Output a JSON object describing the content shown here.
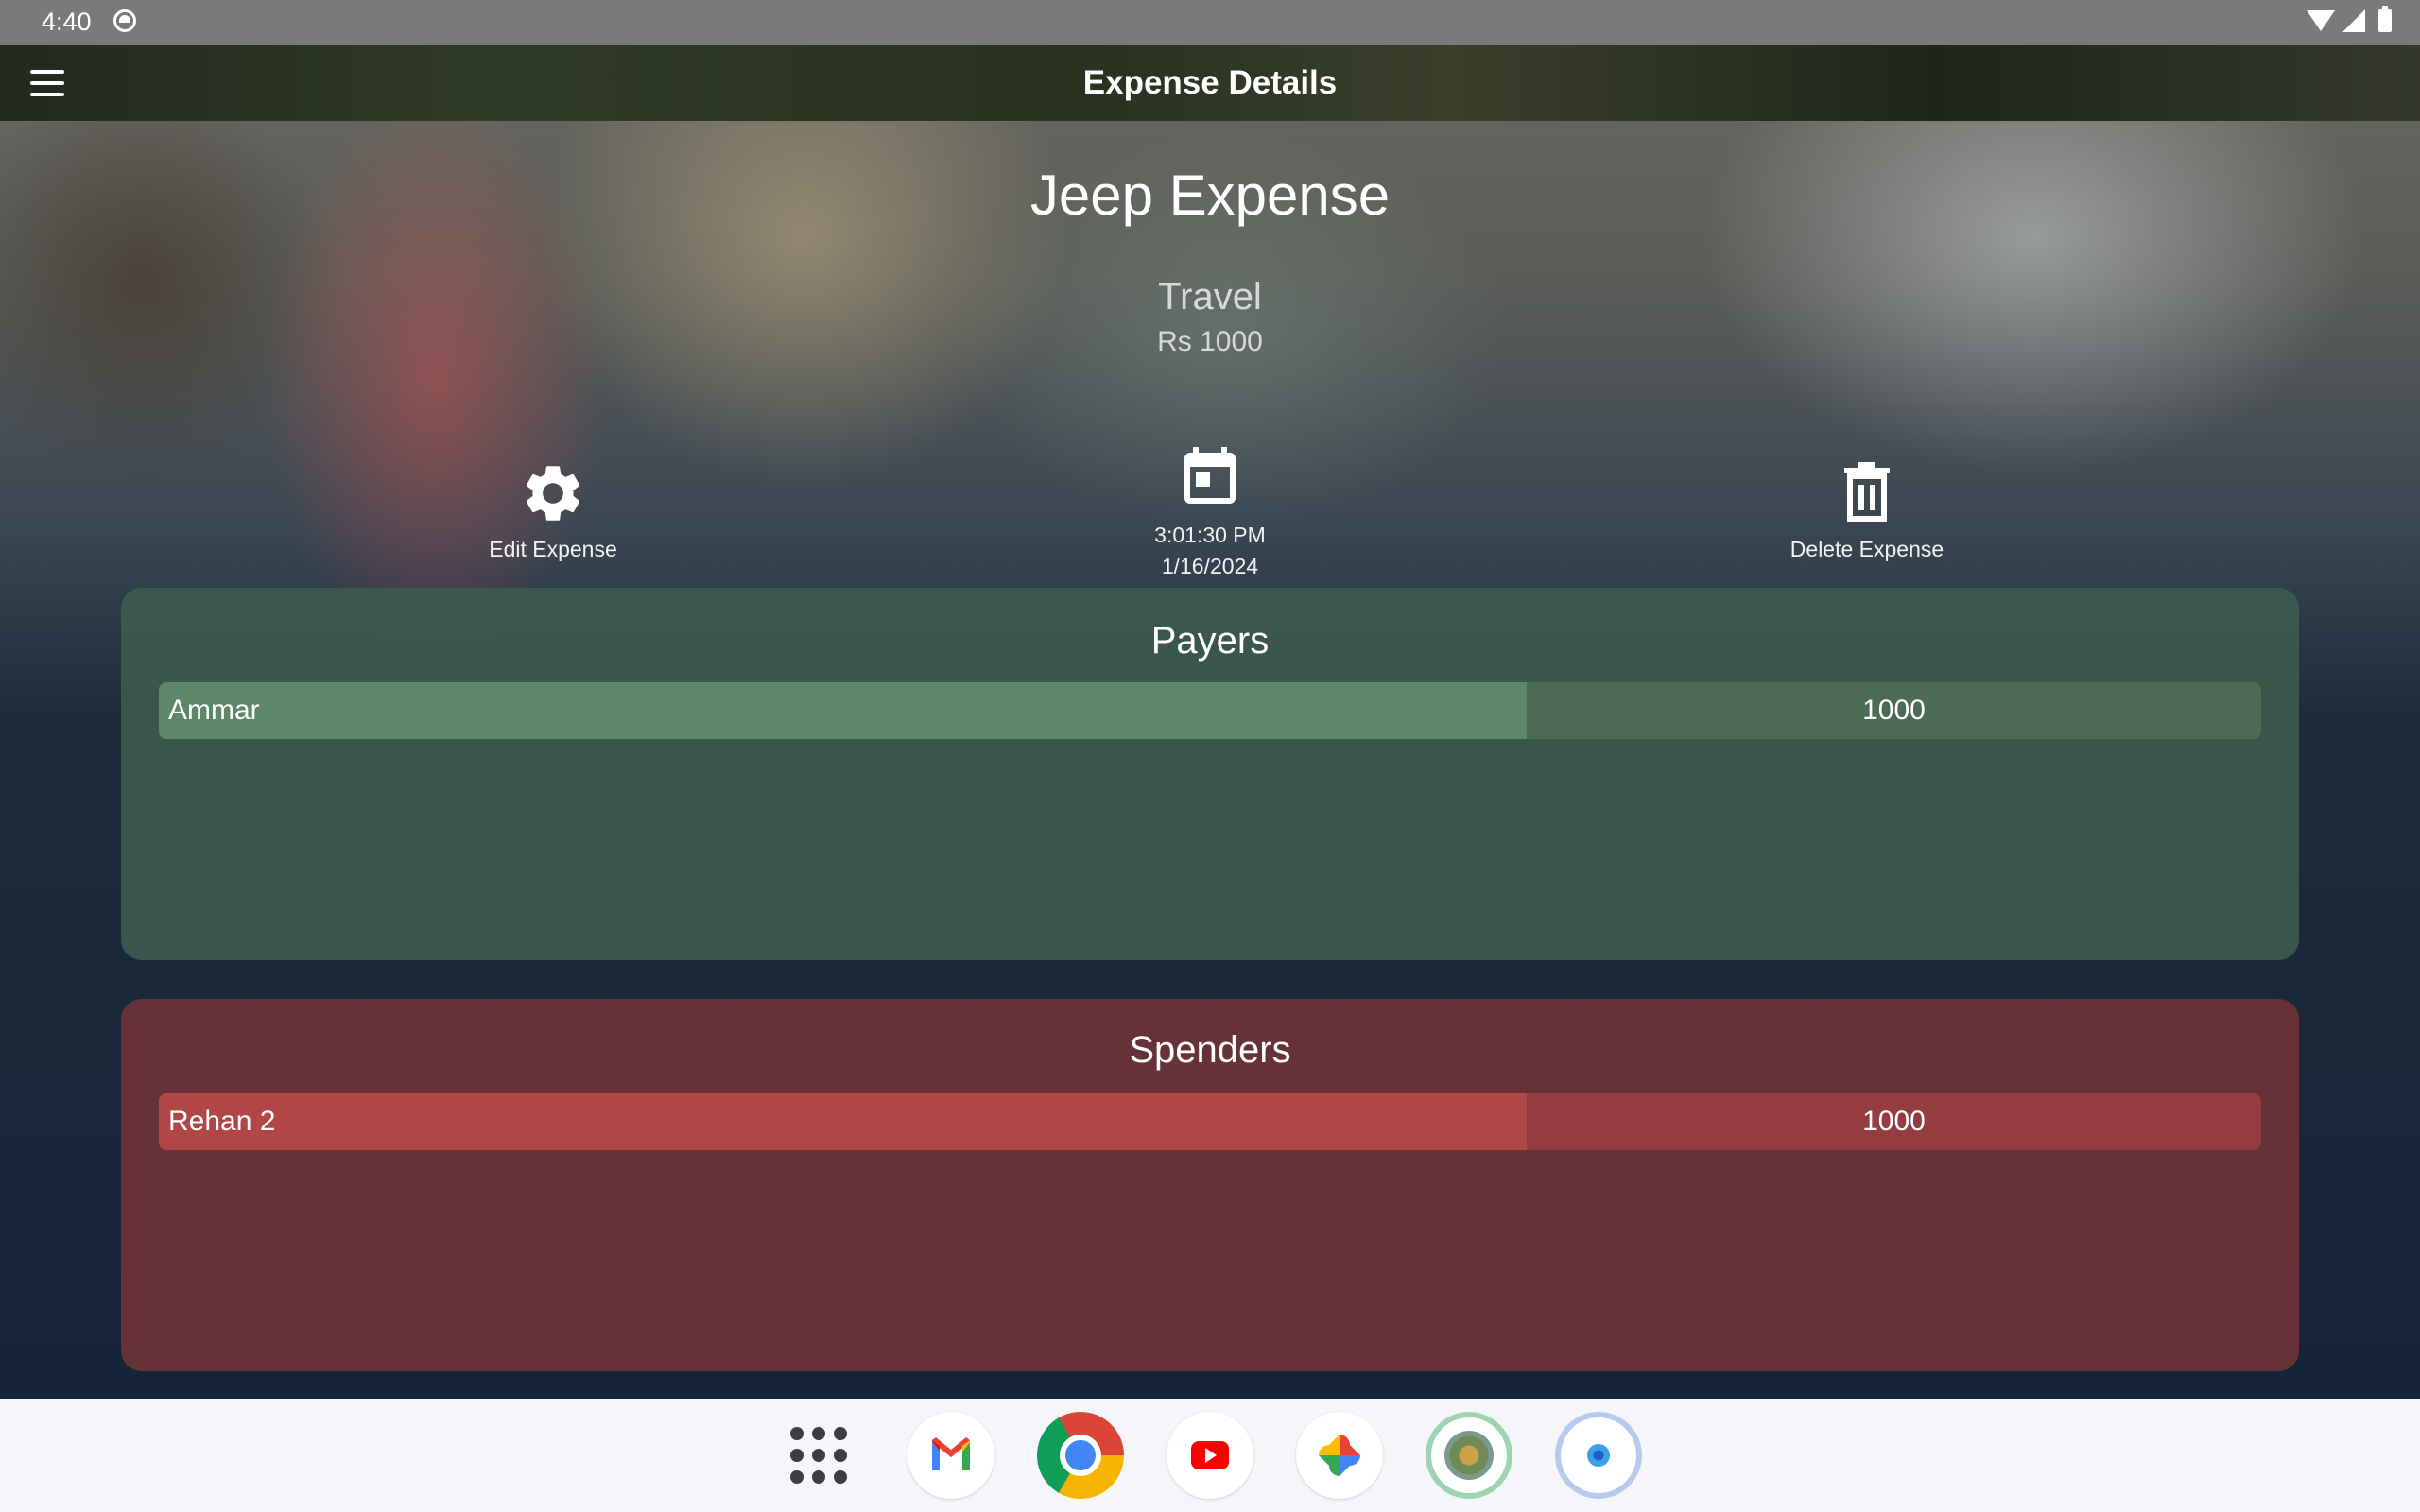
{
  "status_bar": {
    "time": "4:40"
  },
  "app_bar": {
    "title": "Expense Details"
  },
  "expense": {
    "title": "Jeep Expense",
    "category": "Travel",
    "amount": "Rs 1000"
  },
  "actions": {
    "edit_label": "Edit Expense",
    "time": "3:01:30 PM",
    "date": "1/16/2024",
    "delete_label": "Delete Expense"
  },
  "payers": {
    "title": "Payers",
    "entries": [
      {
        "name": "Ammar",
        "amount": "1000"
      }
    ]
  },
  "spenders": {
    "title": "Spenders",
    "entries": [
      {
        "name": "Rehan 2",
        "amount": "1000"
      }
    ]
  },
  "colors": {
    "payers_panel": "#3e5c4e",
    "payers_row": "#5e8669",
    "spenders_panel": "#663137",
    "spenders_row": "#b14647"
  },
  "dock": {
    "apps": [
      "app-drawer-icon",
      "gmail-icon",
      "chrome-icon",
      "youtube-icon",
      "google-photos-icon",
      "app-icon",
      "camera-app-icon"
    ]
  }
}
